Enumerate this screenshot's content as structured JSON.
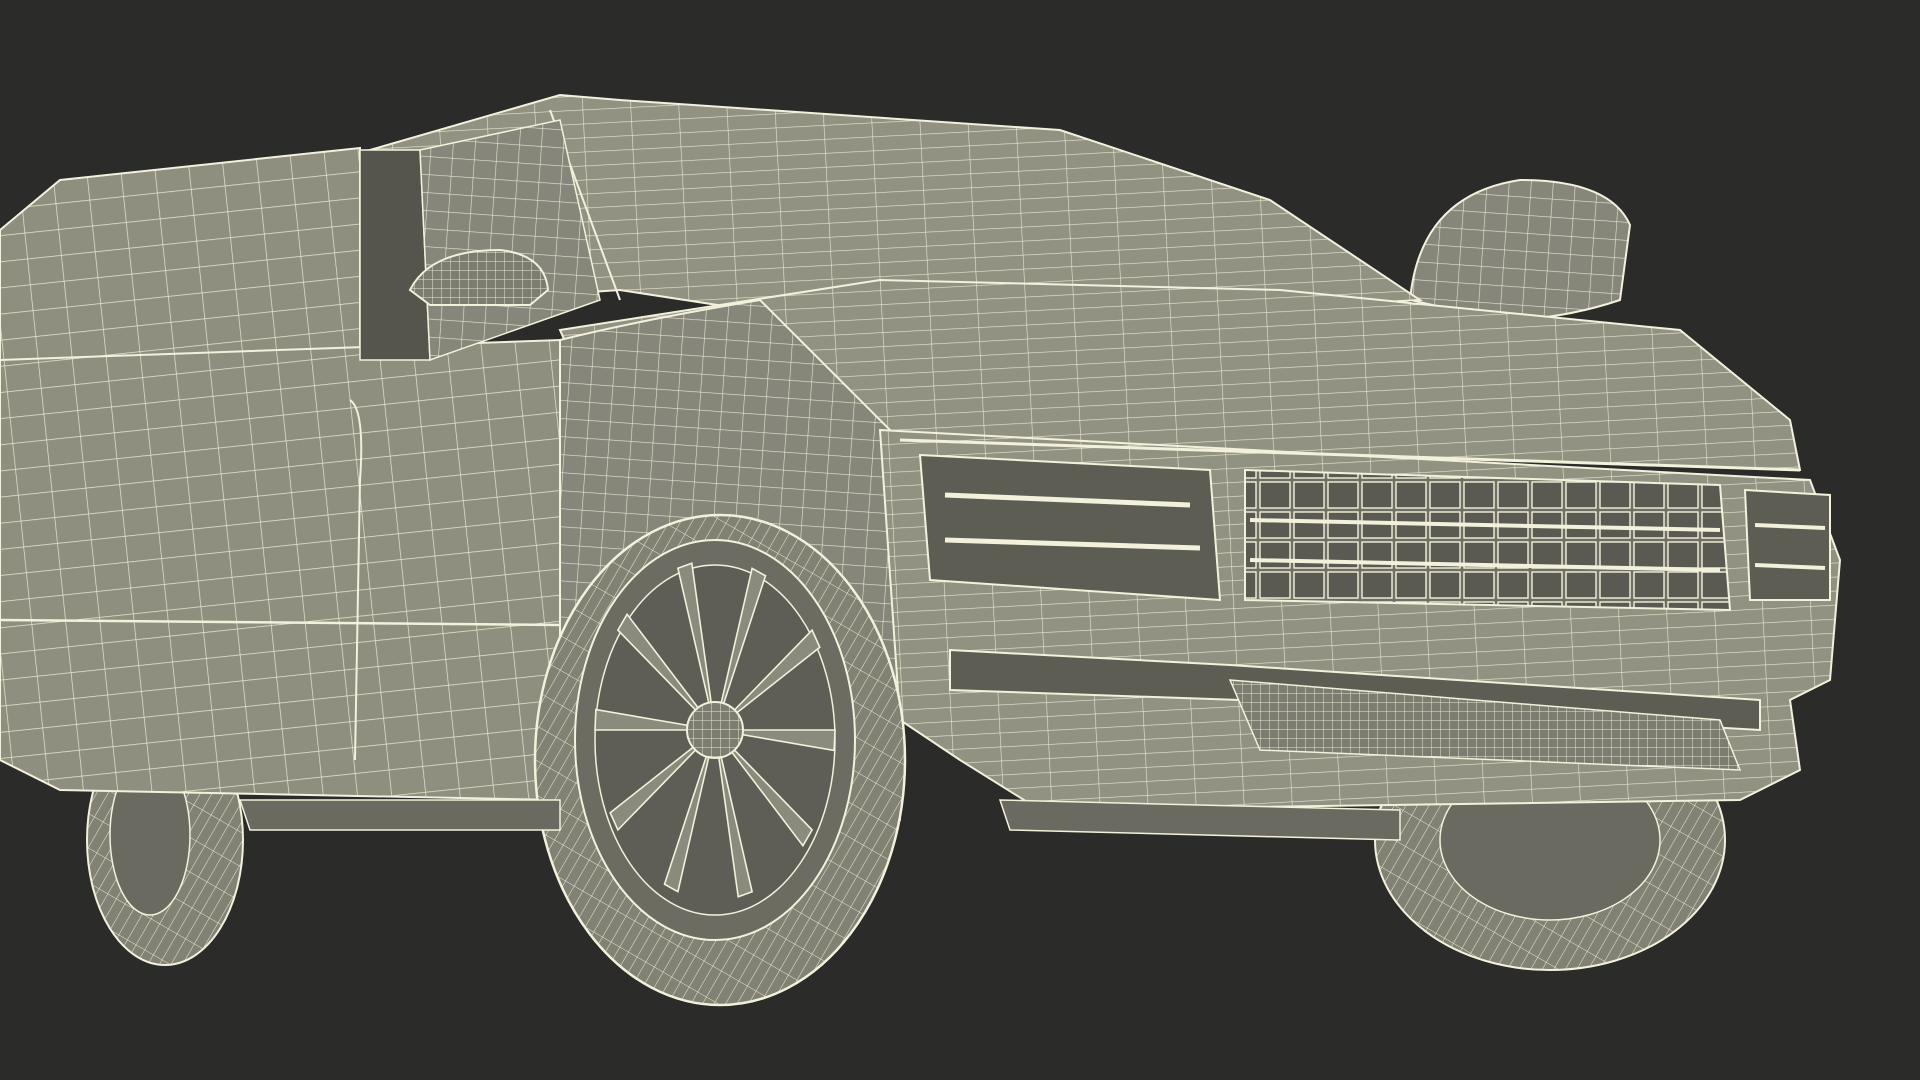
{
  "scene": {
    "subject": "",
    "colors": {
      "background": "#2b2b2a",
      "body_fill": "#8f8f80",
      "body_shade": "#76766a",
      "dark_fill": "#5d5d54",
      "wire": "#f3f1dc"
    }
  }
}
